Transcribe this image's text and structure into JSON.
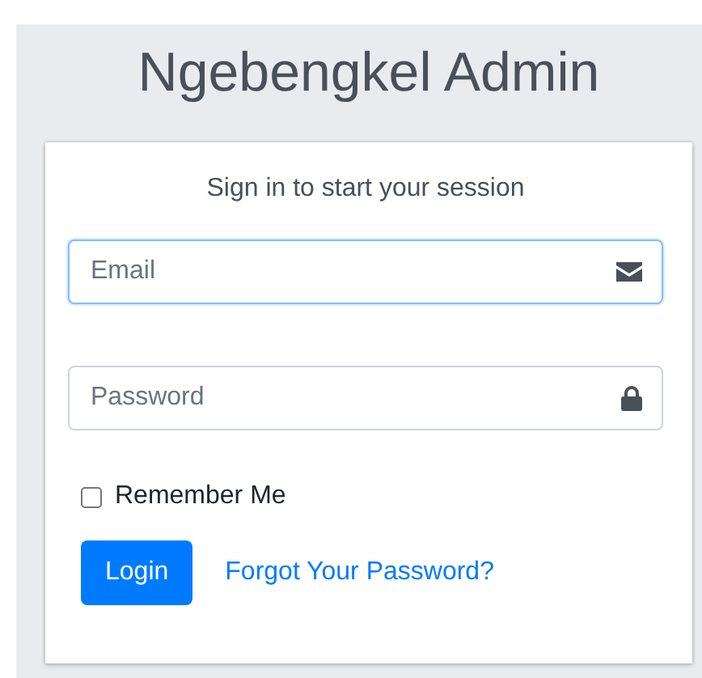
{
  "title": "Ngebengkel Admin",
  "card": {
    "message": "Sign in to start your session",
    "fields": [
      {
        "kind": "email",
        "placeholder": "Email",
        "focused": true
      },
      {
        "kind": "password",
        "placeholder": "Password",
        "focused": false
      }
    ],
    "remember": {
      "label": "Remember Me",
      "checked": false
    },
    "login_button": "Login",
    "forgot_link": "Forgot Your Password?"
  }
}
